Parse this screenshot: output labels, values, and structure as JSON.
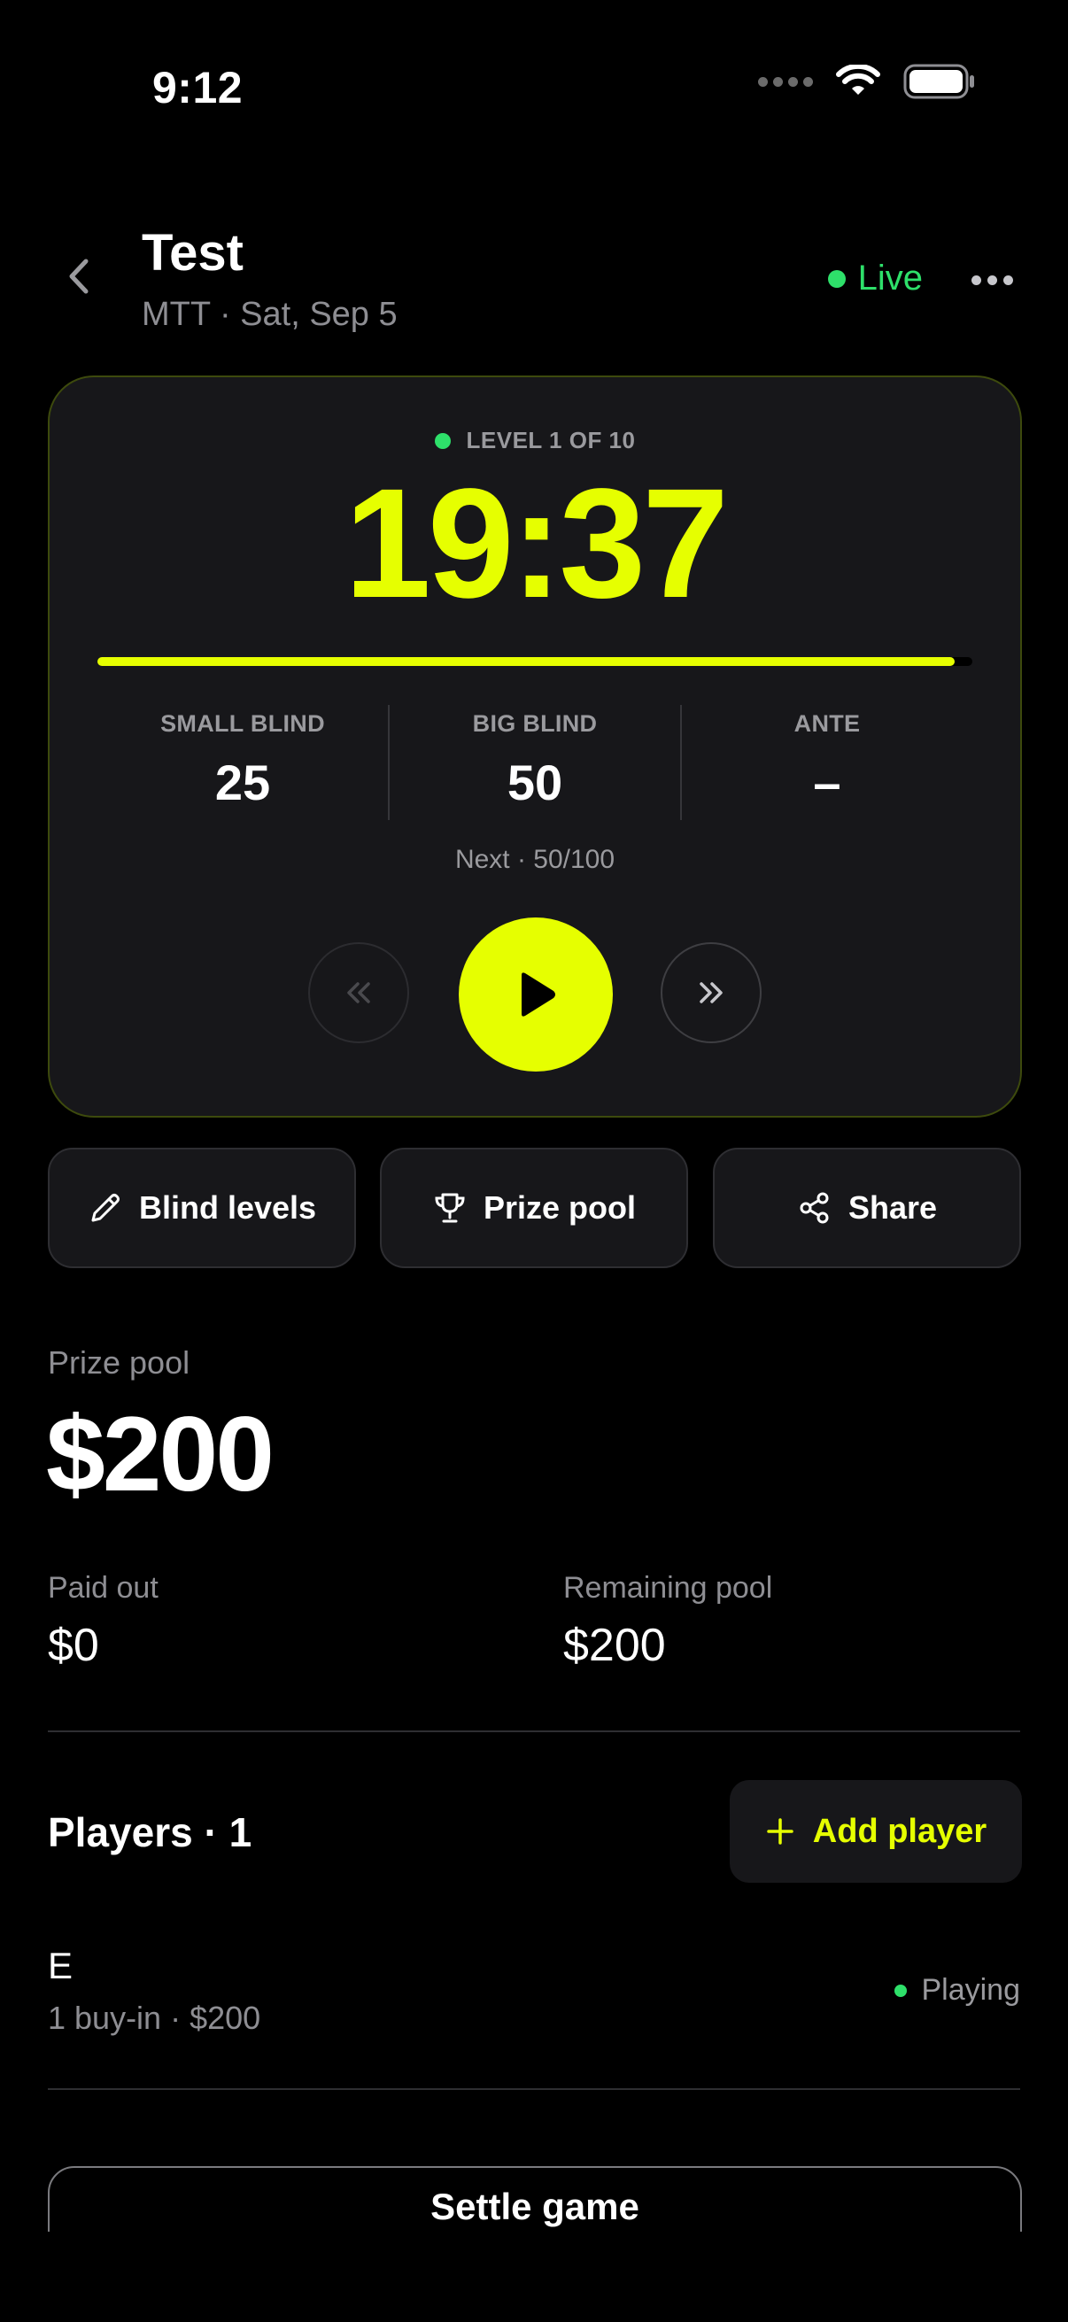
{
  "status_bar": {
    "time": "9:12"
  },
  "header": {
    "title": "Test",
    "subtitle": "MTT · Sat, Sep 5",
    "live_label": "Live"
  },
  "timer": {
    "level_label": "LEVEL 1 OF 10",
    "clock": "19:37",
    "progress_fraction": 0.98,
    "small_blind_label": "SMALL BLIND",
    "small_blind_value": "25",
    "big_blind_label": "BIG BLIND",
    "big_blind_value": "50",
    "ante_label": "ANTE",
    "ante_value": "–",
    "next_level": "Next · 50/100"
  },
  "actions": {
    "blind_levels": "Blind levels",
    "prize_pool": "Prize pool",
    "share": "Share"
  },
  "prize_pool": {
    "label": "Prize pool",
    "amount": "$200",
    "paid_out_label": "Paid out",
    "paid_out_value": "$0",
    "remaining_label": "Remaining pool",
    "remaining_value": "$200"
  },
  "players": {
    "title": "Players · 1",
    "add_label": "Add player",
    "list": [
      {
        "name": "E",
        "meta": "1 buy-in · $200",
        "status": "Playing"
      }
    ]
  },
  "settle_label": "Settle game",
  "colors": {
    "accent": "#e6ff00",
    "live_green": "#2ee06a",
    "card_bg": "#17171a",
    "background": "#000000"
  },
  "icons": {
    "back": "chevron-left-icon",
    "more": "more-horizontal-icon",
    "prev": "double-chevron-left-icon",
    "play": "play-icon",
    "next": "double-chevron-right-icon",
    "blind_levels": "pencil-icon",
    "prize_pool": "trophy-icon",
    "share": "share-icon",
    "add": "plus-icon"
  }
}
